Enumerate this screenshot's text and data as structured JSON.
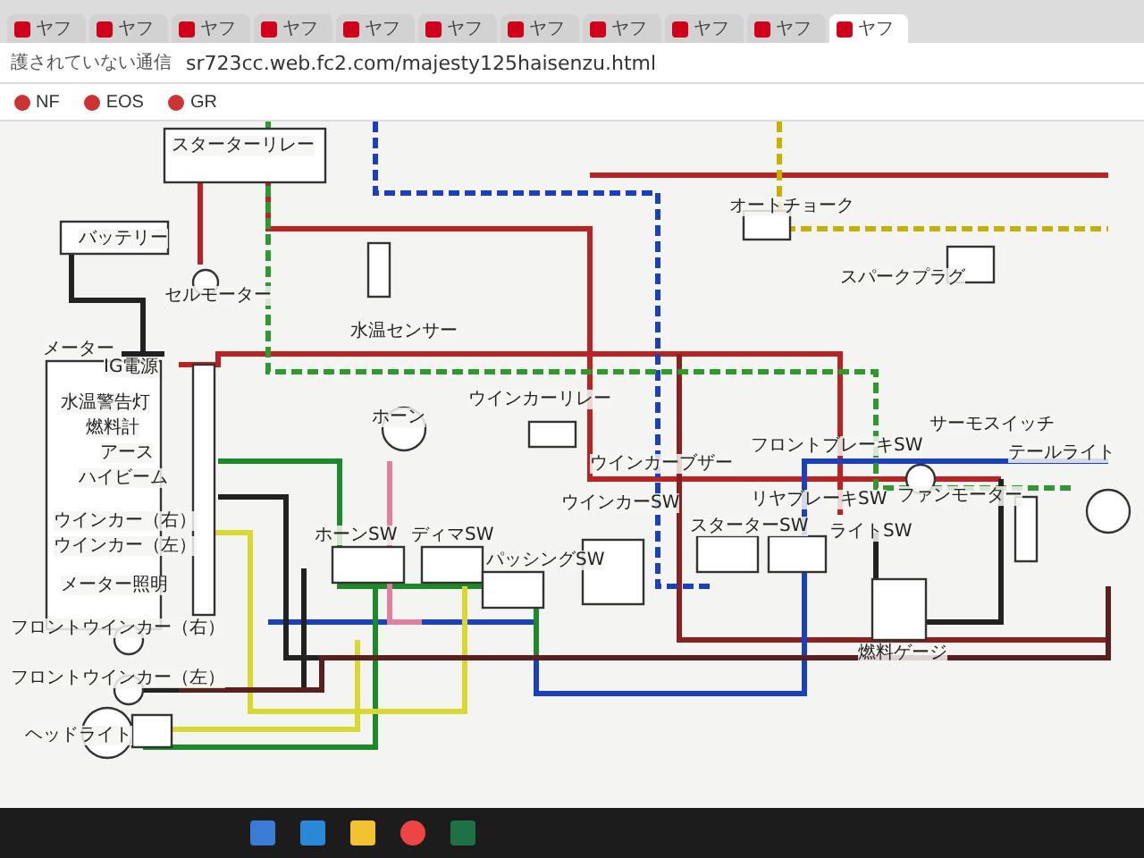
{
  "browser": {
    "tabs": [
      {
        "label": "ヤフ",
        "selected": false
      },
      {
        "label": "ヤフ",
        "selected": false
      },
      {
        "label": "ヤフ",
        "selected": false
      },
      {
        "label": "ヤフ",
        "selected": false
      },
      {
        "label": "ヤフ",
        "selected": false
      },
      {
        "label": "ヤフ",
        "selected": false
      },
      {
        "label": "ヤフ",
        "selected": false
      },
      {
        "label": "ヤフ",
        "selected": false
      },
      {
        "label": "ヤフ",
        "selected": false
      },
      {
        "label": "ヤフ",
        "selected": false
      },
      {
        "label": "ヤフ",
        "selected": true
      }
    ],
    "security_note": "護されていない通信",
    "url": "sr723cc.web.fc2.com/majesty125haisenzu.html",
    "bookmarks": [
      "NF",
      "EOS",
      "GR"
    ]
  },
  "diagram": {
    "components": [
      "スターターリレー",
      "バッテリー",
      "セルモーター",
      "メーター",
      "水温センサー",
      "オートチョーク",
      "スパークプラグ",
      "ホーン",
      "ウインカーリレー",
      "ウインカーブザー",
      "フロントブレーキSW",
      "リヤブレーキSW",
      "サーモスイッチ",
      "ファンモーター",
      "テールライト",
      "ホーンSW",
      "ディマSW",
      "パッシングSW",
      "ウインカーSW",
      "スターターSW",
      "ライトSW",
      "燃料ゲージ",
      "フロントウインカー（右）",
      "フロントウインカー（左）",
      "ヘッドライト"
    ],
    "meter_terminals": [
      "IG電源",
      "水温警告灯",
      "燃料計",
      "アース",
      "ハイビーム",
      "ウインカー（右）",
      "ウインカー（左）",
      "メーター照明"
    ]
  }
}
